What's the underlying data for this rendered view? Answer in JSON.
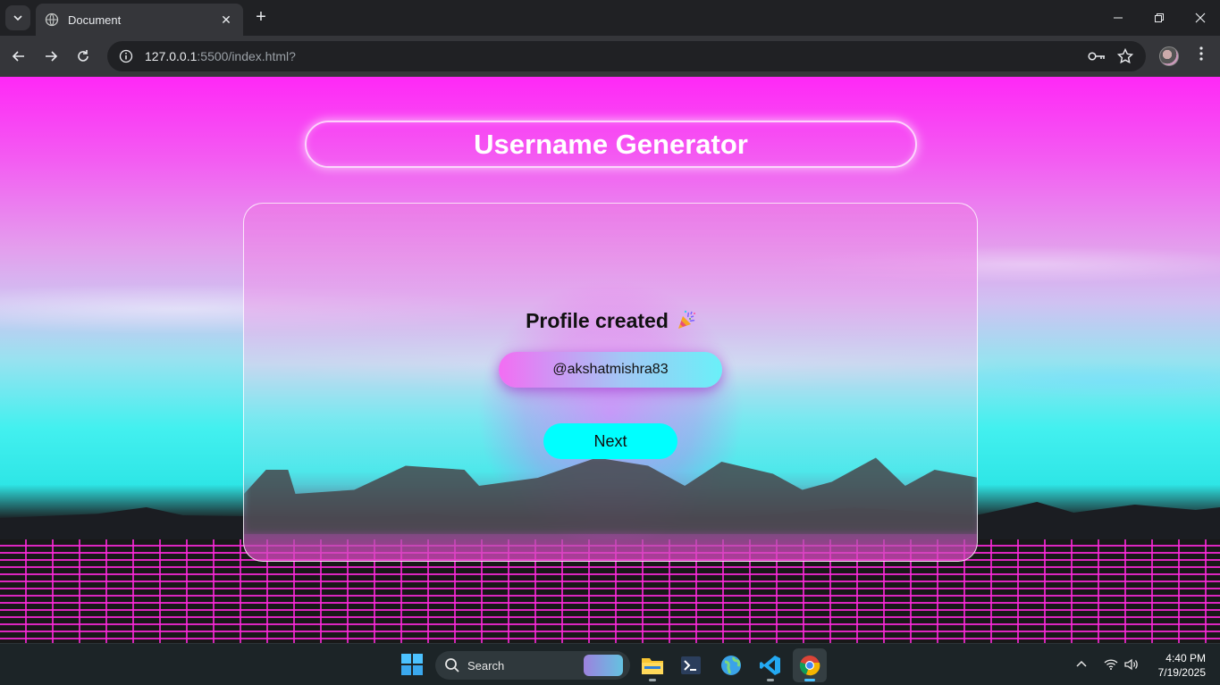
{
  "browser": {
    "tab_title": "Document",
    "new_tab_symbol": "+",
    "url_host": "127.0.0.1",
    "url_rest": ":5500/index.html?"
  },
  "page": {
    "title": "Username Generator",
    "status_text": "Profile created",
    "username": "@akshatmishra83",
    "next_label": "Next"
  },
  "taskbar": {
    "search_placeholder": "Search",
    "time": "4:40 PM",
    "date": "7/19/2025"
  },
  "colors": {
    "sky_top": "#ff28f6",
    "accent_cyan": "#00ffff",
    "grid_magenta": "#ff28dc"
  }
}
